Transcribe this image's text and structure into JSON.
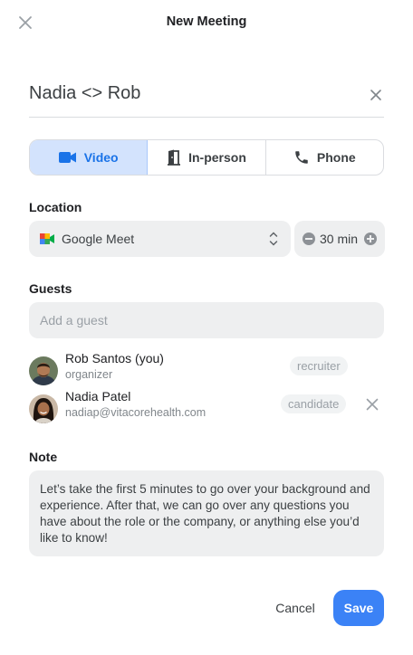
{
  "header": {
    "title": "New Meeting",
    "close_icon": "close-icon"
  },
  "meeting": {
    "title": "Nadia <> Rob",
    "clear_icon": "clear-icon"
  },
  "meeting_types": [
    {
      "label": "Video",
      "icon": "video-camera-icon",
      "selected": true
    },
    {
      "label": "In-person",
      "icon": "door-icon",
      "selected": false
    },
    {
      "label": "Phone",
      "icon": "phone-icon",
      "selected": false
    }
  ],
  "location": {
    "label": "Location",
    "value": "Google Meet",
    "icon": "google-meet-icon",
    "duration": "30 min"
  },
  "guests": {
    "label": "Guests",
    "placeholder": "Add a guest",
    "list": [
      {
        "name": "Rob Santos (you)",
        "sub": "organizer",
        "role": "recruiter",
        "removable": false
      },
      {
        "name": "Nadia Patel",
        "sub": "nadiap@vitacorehealth.com",
        "role": "candidate",
        "removable": true
      }
    ]
  },
  "note": {
    "label": "Note",
    "text": "Let’s take the first 5 minutes to go over your background and experience. After that, we can go over any questions you have about the role or the company, or anything else you’d like to know!"
  },
  "actions": {
    "cancel": "Cancel",
    "save": "Save"
  },
  "colors": {
    "accent": "#3b82f6",
    "selected_bg": "#d3e3fd",
    "field_bg": "#eeeff0"
  }
}
